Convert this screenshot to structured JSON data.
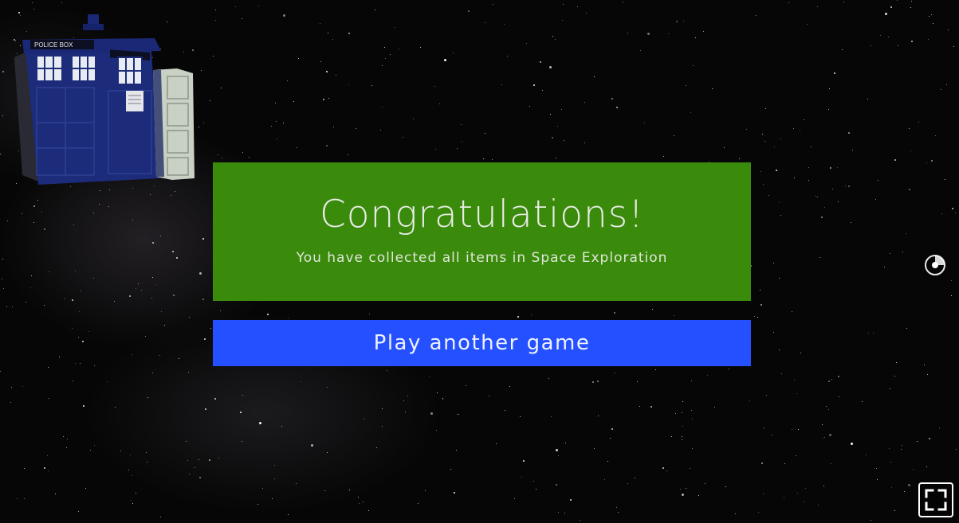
{
  "scene": {
    "background_color": "#060606"
  },
  "tardis": {
    "sign_text": "POLICE BOX",
    "body_color": "#1a2a78",
    "door_color": "#c9d0c4"
  },
  "congrats": {
    "title": "Congratulations!",
    "message": "You have collected all items in Space Exploration",
    "panel_color": "#3a8a0c"
  },
  "play_button": {
    "label": "Play another game",
    "color": "#2450ff"
  },
  "icons": {
    "orb": "crosshair-orb-icon",
    "fullscreen": "fullscreen-icon"
  }
}
